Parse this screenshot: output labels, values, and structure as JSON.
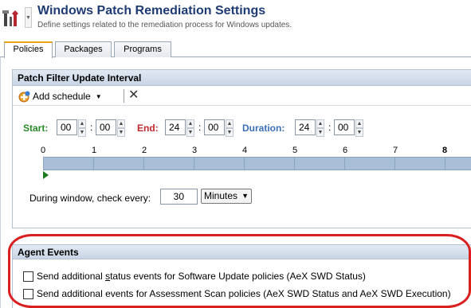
{
  "header": {
    "title": "Windows Patch Remediation Settings",
    "subtitle": "Define settings related to the remediation process for Windows updates.",
    "icon": "tools-icon"
  },
  "tabs": [
    {
      "label": "Policies",
      "active": true
    },
    {
      "label": "Packages",
      "active": false
    },
    {
      "label": "Programs",
      "active": false
    }
  ],
  "interval_panel": {
    "title": "Patch Filter Update Interval",
    "add_schedule_label": "Add schedule",
    "start_label": "Start:",
    "start_hour": "00",
    "start_min": "00",
    "end_label": "End:",
    "end_hour": "24",
    "end_min": "00",
    "duration_label": "Duration:",
    "duration_hour": "24",
    "duration_min": "00",
    "colon": ":",
    "ruler": [
      "0",
      "1",
      "2",
      "3",
      "4",
      "5",
      "6",
      "7",
      "8"
    ],
    "check_label": "During window, check every:",
    "check_value": "30",
    "check_unit": "Minutes"
  },
  "agent_events": {
    "title": "Agent Events",
    "option1_prefix": "Send additional ",
    "option1_underlined": "s",
    "option1_suffix": "tatus events for Software Update policies (AeX SWD Status)",
    "option1_checked": false,
    "option2_label": "Send additional events for Assessment Scan policies (AeX SWD Status and AeX SWD Execution)",
    "option2_checked": false
  },
  "colors": {
    "title": "#1f3b73",
    "start": "#2a8a2a",
    "end": "#c0272d",
    "duration": "#3b6fb6",
    "timeline": "#a9bfd8",
    "highlight": "#d9201f"
  }
}
